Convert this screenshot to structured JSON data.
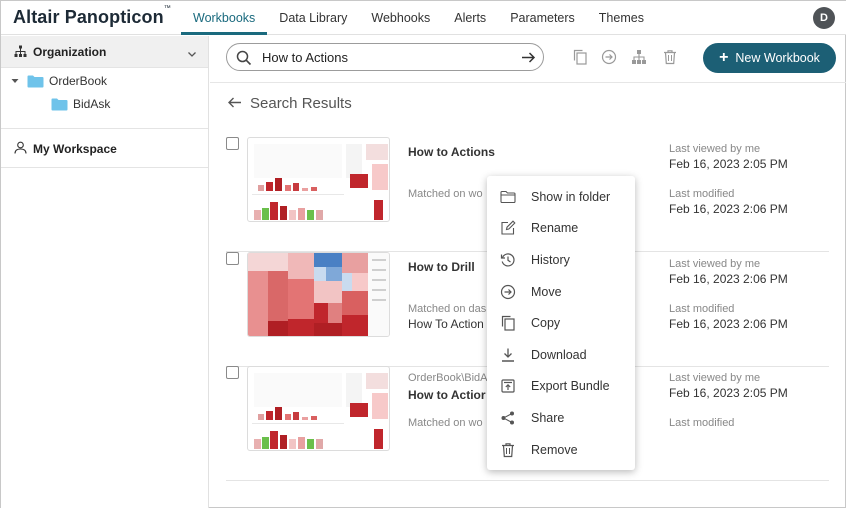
{
  "app": {
    "brand": "Altair Panopticon",
    "brand_mark": "™",
    "user_initial": "D"
  },
  "nav": {
    "tabs": [
      {
        "label": "Workbooks",
        "active": true
      },
      {
        "label": "Data Library",
        "active": false
      },
      {
        "label": "Webhooks",
        "active": false
      },
      {
        "label": "Alerts",
        "active": false
      },
      {
        "label": "Parameters",
        "active": false
      },
      {
        "label": "Themes",
        "active": false
      }
    ]
  },
  "sidebar": {
    "organization_label": "Organization",
    "tree": [
      {
        "label": "OrderBook",
        "expanded": true
      },
      {
        "label": "BidAsk"
      }
    ],
    "workspace_label": "My Workspace"
  },
  "toolbar": {
    "search_value": "How to Actions",
    "new_workbook_label": "New Workbook",
    "icons": [
      "copy-icon",
      "move-icon",
      "hierarchy-icon",
      "trash-icon"
    ]
  },
  "results": {
    "title": "Search Results",
    "items": [
      {
        "path": "",
        "name": "How to Actions",
        "match": "Matched on wo",
        "sub": "",
        "last_viewed_label": "Last viewed by me",
        "last_viewed": "Feb 16, 2023 2:05 PM",
        "last_modified_label": "Last modified",
        "last_modified": "Feb 16, 2023 2:06 PM"
      },
      {
        "path": "",
        "name": "How to Drill",
        "match": "Matched on das",
        "sub": "How To Action",
        "last_viewed_label": "Last viewed by me",
        "last_viewed": "Feb 16, 2023 2:06 PM",
        "last_modified_label": "Last modified",
        "last_modified": "Feb 16, 2023 2:06 PM"
      },
      {
        "path": "OrderBook\\BidA",
        "name": "How to Actior",
        "match": "Matched on wo",
        "sub": "",
        "last_viewed_label": "Last viewed by me",
        "last_viewed": "Feb 16, 2023 2:05 PM",
        "last_modified_label": "Last modified",
        "last_modified": ""
      }
    ]
  },
  "context_menu": {
    "items": [
      {
        "label": "Show in folder",
        "icon": "folder-outline-icon"
      },
      {
        "label": "Rename",
        "icon": "edit-icon"
      },
      {
        "label": "History",
        "icon": "history-icon"
      },
      {
        "label": "Move",
        "icon": "move-icon"
      },
      {
        "label": "Copy",
        "icon": "copy-icon"
      },
      {
        "label": "Download",
        "icon": "download-icon"
      },
      {
        "label": "Export Bundle",
        "icon": "export-bundle-icon"
      },
      {
        "label": "Share",
        "icon": "share-icon"
      },
      {
        "label": "Remove",
        "icon": "trash-icon"
      }
    ]
  },
  "colors": {
    "accent": "#1a6a7e",
    "primary_button": "#1c5f75",
    "folder": "#6fc3ea",
    "thumb_red": "#c0262c",
    "thumb_green": "#6abf4b",
    "thumb_blue": "#4a80c4"
  }
}
